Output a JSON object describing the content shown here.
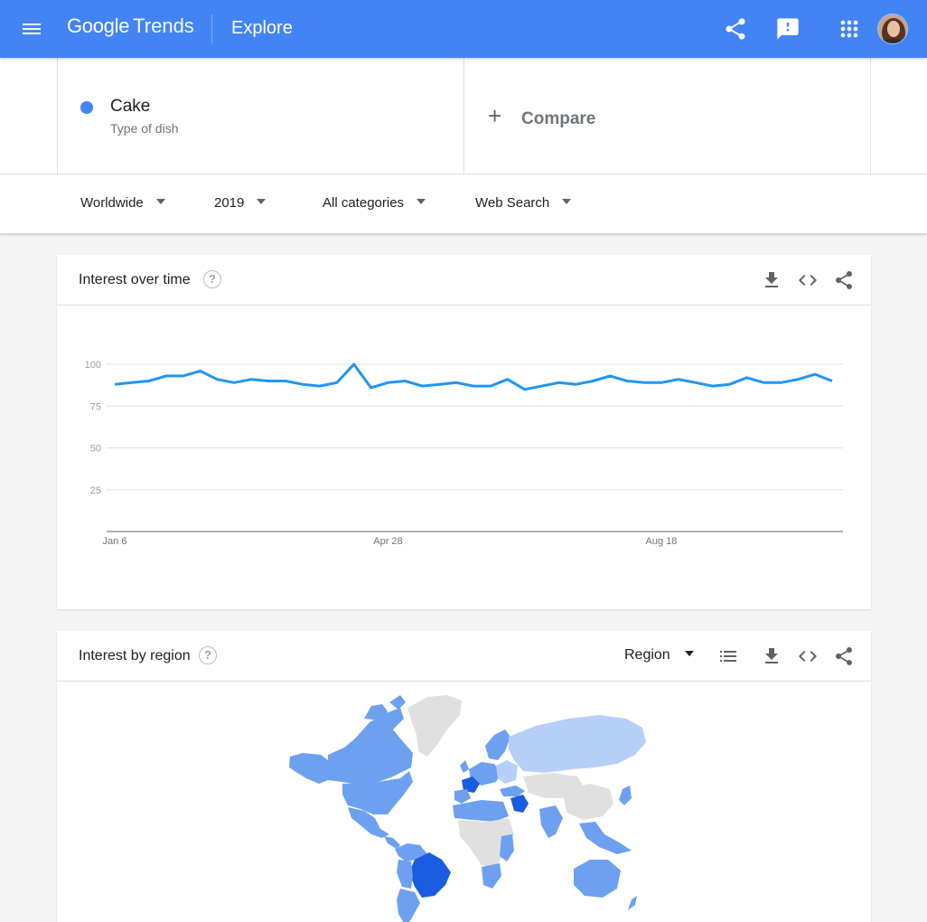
{
  "header": {
    "logo_google": "Google",
    "logo_trends": "Trends",
    "section": "Explore",
    "icons": [
      "menu-icon",
      "share-icon",
      "feedback-icon",
      "apps-icon"
    ]
  },
  "term": {
    "name": "Cake",
    "type": "Type of dish",
    "color": "#4285f4"
  },
  "compare": {
    "plus": "+",
    "label": "Compare"
  },
  "filters": {
    "location": "Worldwide",
    "time": "2019",
    "category": "All categories",
    "property": "Web Search"
  },
  "interest_over_time": {
    "title": "Interest over time",
    "help": "?"
  },
  "interest_by_region": {
    "title": "Interest by region",
    "help": "?",
    "resolution": "Region"
  },
  "colors": {
    "appbar": "#4384f4",
    "line": "#2196f3",
    "map_strong": "#1a5ce0",
    "map_mid": "#6ea0f0",
    "map_light": "#b6cff7",
    "map_none": "#e0e0e0"
  },
  "chart_data": {
    "type": "line",
    "series": [
      {
        "name": "Cake",
        "values": [
          88,
          89,
          90,
          93,
          93,
          96,
          91,
          89,
          91,
          90,
          90,
          88,
          87,
          89,
          100,
          86,
          89,
          90,
          87,
          88,
          89,
          87,
          87,
          91,
          85,
          87,
          89,
          88,
          90,
          93,
          90,
          89,
          89,
          91,
          89,
          87,
          88,
          92,
          89,
          89,
          91,
          94,
          90
        ]
      }
    ],
    "x_tick_labels": [
      "Jan 6",
      "Apr 28",
      "Aug 18"
    ],
    "x_tick_indices": [
      0,
      16,
      32
    ],
    "y_ticks": [
      25,
      50,
      75,
      100
    ],
    "ylim": [
      0,
      100
    ],
    "grid": true
  }
}
